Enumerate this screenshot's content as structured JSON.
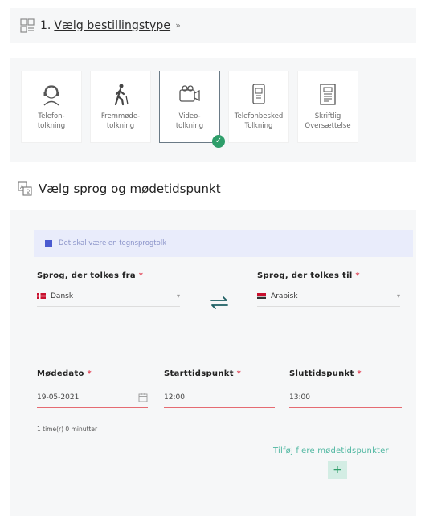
{
  "section1": {
    "number": "1.",
    "title": "Vælg bestillingstype",
    "chevron": "»"
  },
  "types": [
    {
      "label": "Telefon-\ntolkning",
      "icon": "headset-person-icon",
      "selected": false
    },
    {
      "label": "Fremmøde-\ntolkning",
      "icon": "walking-person-icon",
      "selected": false
    },
    {
      "label": "Video-\ntolkning",
      "icon": "video-call-icon",
      "selected": true
    },
    {
      "label": "Telefonbesked\nTolkning",
      "icon": "phone-message-icon",
      "selected": false
    },
    {
      "label": "Skriftlig\nOversættelse",
      "icon": "document-icon",
      "selected": false
    }
  ],
  "section2": {
    "title": "Vælg sprog og mødetidspunkt"
  },
  "sign_language": {
    "label": "Det skal være en tegnsprogtolk",
    "checked": true
  },
  "from_lang": {
    "label": "Sprog, der tolkes fra",
    "required": "*",
    "value": "Dansk"
  },
  "to_lang": {
    "label": "Sprog, der tolkes til",
    "required": "*",
    "value": "Arabisk"
  },
  "date": {
    "label": "Mødedato",
    "required": "*",
    "value": "19-05-2021"
  },
  "start": {
    "label": "Starttidspunkt",
    "required": "*",
    "value": "12:00"
  },
  "end": {
    "label": "Sluttidspunkt",
    "required": "*",
    "value": "13:00"
  },
  "duration": "1 time(r) 0 minutter",
  "add_more": {
    "label": "Tilføj flere mødetidspunkter",
    "button": "+"
  },
  "colors": {
    "accent": "#2e9e6a",
    "link": "#4fb7a1",
    "required": "#e2495b",
    "checkbox": "#4a5ad0"
  }
}
